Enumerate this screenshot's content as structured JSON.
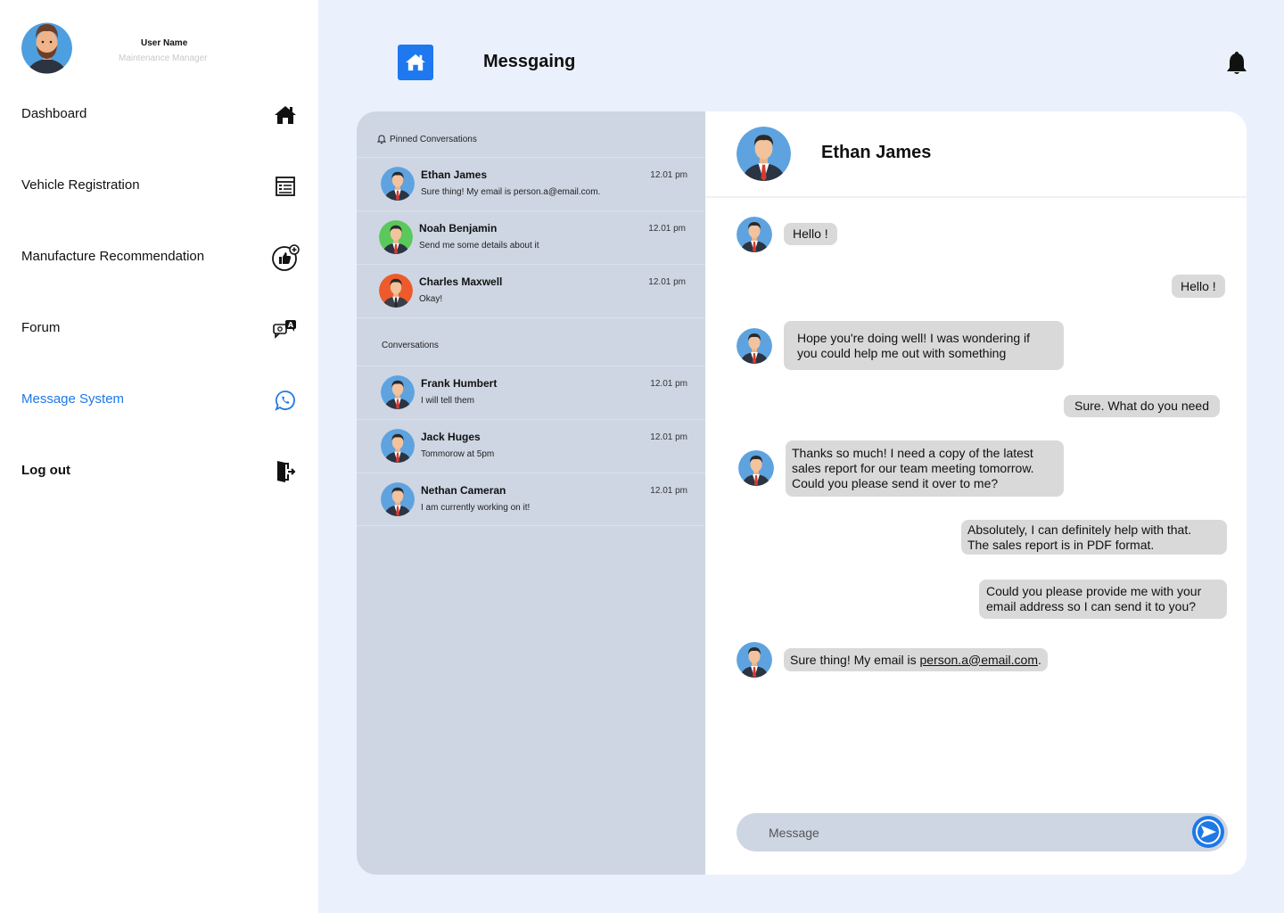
{
  "user": {
    "name": "User Name",
    "role": "Maintenance Manager"
  },
  "nav": [
    {
      "label": "Dashboard",
      "icon": "home-icon"
    },
    {
      "label": "Vehicle Registration",
      "icon": "registration-form-icon"
    },
    {
      "label": "Manufacture Recommendation",
      "icon": "thumbs-up-icon"
    },
    {
      "label": "Forum",
      "icon": "forum-chat-icon"
    },
    {
      "label": "Message System",
      "icon": "whatsapp-icon",
      "active": true
    },
    {
      "label": "Log out",
      "icon": "logout-door-icon"
    }
  ],
  "header": {
    "title": "Messgaing"
  },
  "sections": {
    "pinned": "Pinned Conversations",
    "conversations": "Conversations"
  },
  "pinned": [
    {
      "name": "Ethan James",
      "message": "Sure thing! My email is person.a@email.com.",
      "time": "12.01 pm"
    },
    {
      "name": "Noah Benjamin",
      "message": "Send me some details about it",
      "time": "12.01 pm"
    },
    {
      "name": "Charles Maxwell",
      "message": "Okay!",
      "time": "12.01 pm"
    }
  ],
  "conversations": [
    {
      "name": "Frank Humbert",
      "message": "I will tell them",
      "time": "12.01 pm"
    },
    {
      "name": "Jack Huges",
      "message": "Tommorow at 5pm",
      "time": "12.01 pm"
    },
    {
      "name": "Nethan Cameran",
      "message": "I am currently working on it!",
      "time": "12.01 pm"
    }
  ],
  "chat": {
    "contact": "Ethan James",
    "messages": [
      {
        "from": "them",
        "text": "Hello !"
      },
      {
        "from": "me",
        "text": "Hello !"
      },
      {
        "from": "them",
        "text": "Hope you're doing well! I was wondering if\nyou could help me out with something"
      },
      {
        "from": "me",
        "text": "Sure. What do you need"
      },
      {
        "from": "them",
        "text": "Thanks so much! I need a copy of the latest\nsales report for our team meeting tomorrow.\nCould you please send it over to me?"
      },
      {
        "from": "me",
        "text": "Absolutely, I can definitely help with that.\nThe sales report is in PDF format."
      },
      {
        "from": "me",
        "text": "Could you please provide me with your\nemail address so I can send it to you?"
      },
      {
        "from": "them",
        "text_before": "Sure thing! My email is ",
        "email": "person.a@email.com",
        "text_after": "."
      }
    ],
    "input_placeholder": "Message"
  },
  "colors": {
    "accent": "#1e78e6",
    "main_bg": "#eaf1fc",
    "list_bg": "#ced6e3",
    "bubble": "#d9d9d9"
  }
}
